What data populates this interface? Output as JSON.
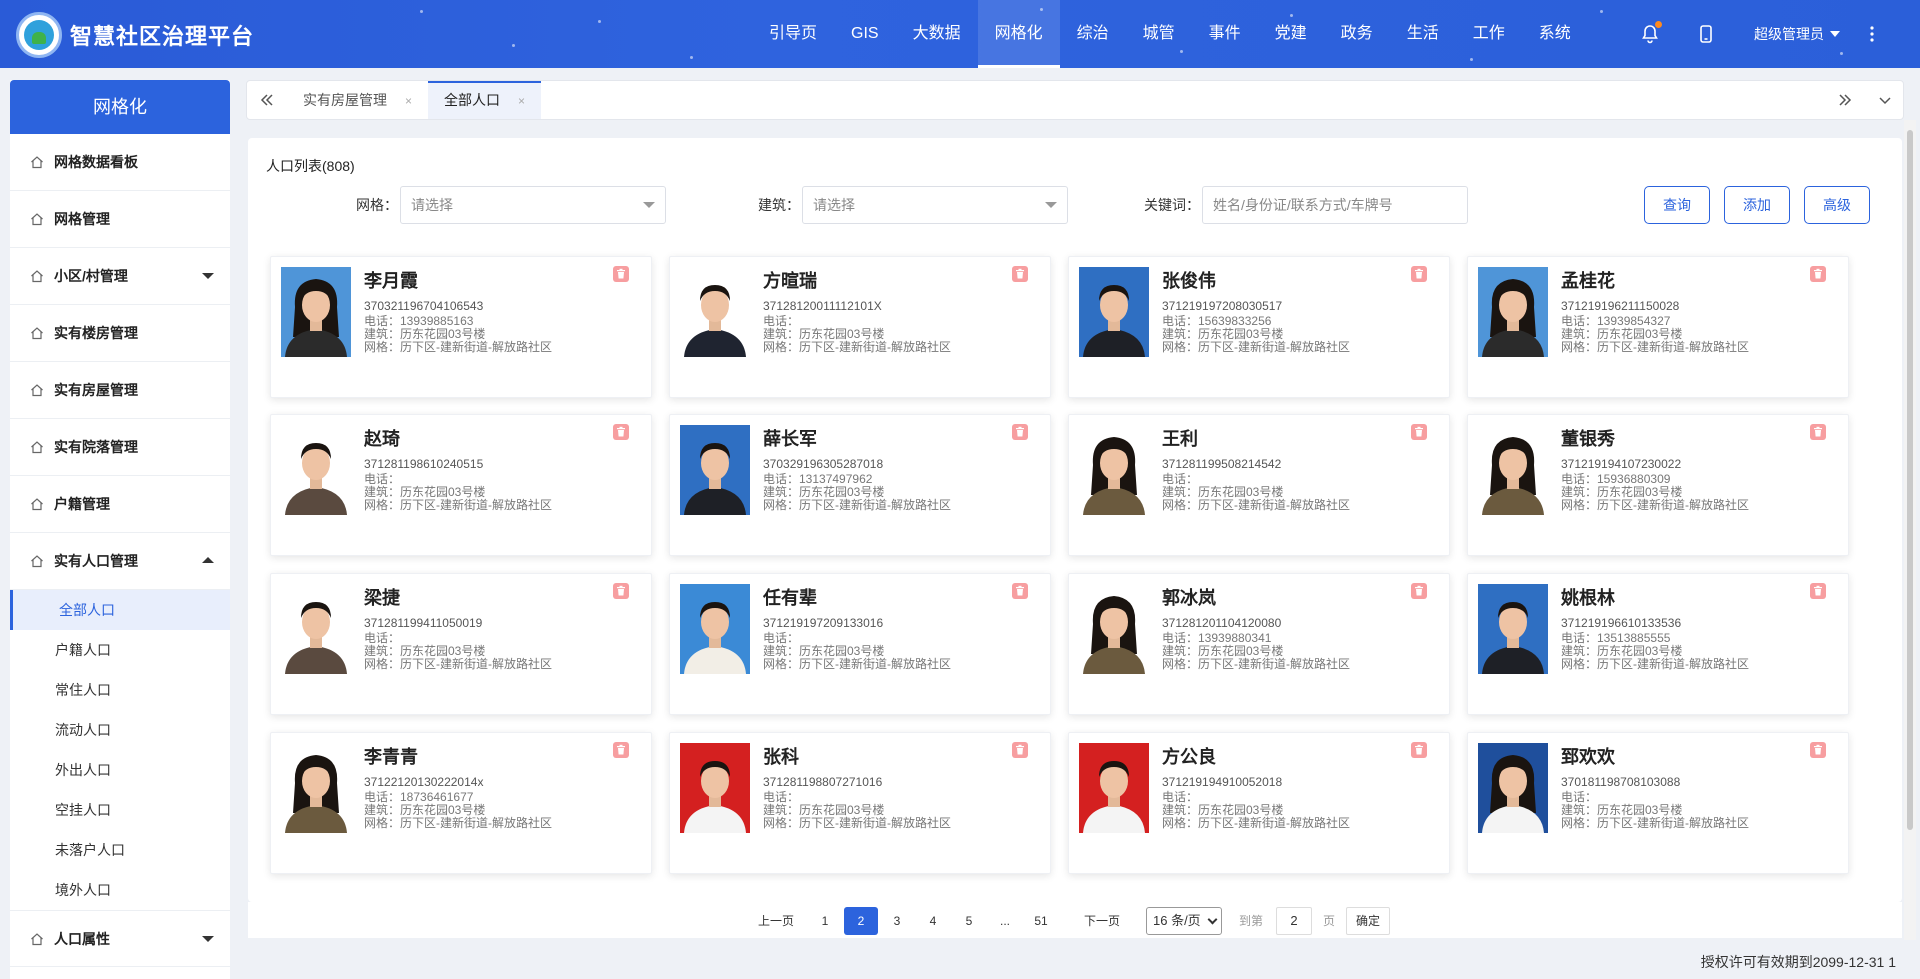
{
  "app": {
    "title": "智慧社区治理平台"
  },
  "topnav": [
    {
      "label": "引导页"
    },
    {
      "label": "GIS"
    },
    {
      "label": "大数据"
    },
    {
      "label": "网格化"
    },
    {
      "label": "综治"
    },
    {
      "label": "城管"
    },
    {
      "label": "事件"
    },
    {
      "label": "党建"
    },
    {
      "label": "政务"
    },
    {
      "label": "生活"
    },
    {
      "label": "工作"
    },
    {
      "label": "系统"
    }
  ],
  "header": {
    "user": "超级管理员"
  },
  "sidebar": {
    "title": "网格化",
    "items": [
      {
        "label": "网格数据看板"
      },
      {
        "label": "网格管理"
      },
      {
        "label": "小区/村管理"
      },
      {
        "label": "实有楼房管理"
      },
      {
        "label": "实有房屋管理"
      },
      {
        "label": "实有院落管理"
      },
      {
        "label": "户籍管理"
      },
      {
        "label": "实有人口管理"
      }
    ],
    "subitems": [
      {
        "label": "全部人口"
      },
      {
        "label": "户籍人口"
      },
      {
        "label": "常住人口"
      },
      {
        "label": "流动人口"
      },
      {
        "label": "外出人口"
      },
      {
        "label": "空挂人口"
      },
      {
        "label": "未落户人口"
      },
      {
        "label": "境外人口"
      }
    ],
    "last_item": {
      "label": "人口属性"
    }
  },
  "tabs": [
    {
      "label": "实有房屋管理",
      "close": "×"
    },
    {
      "label": "全部人口",
      "close": "×"
    }
  ],
  "main": {
    "list_title": "人口列表(808)",
    "filters": {
      "grid_label": "网格：",
      "grid_placeholder": "请选择",
      "building_label": "建筑：",
      "building_placeholder": "请选择",
      "keyword_label": "关键词：",
      "keyword_placeholder": "姓名/身份证/联系方式/车牌号"
    },
    "buttons": {
      "query": "查询",
      "add": "添加",
      "advanced": "高级"
    }
  },
  "people": [
    {
      "name": "李月霞",
      "id": "370321196704106543",
      "phone": "电话：13939885163",
      "building": "建筑：历东花园03号楼",
      "grid": "网格：历下区-建新街道-解放路社区",
      "photo_bg": "#4f95d8",
      "gender": "f",
      "clothes": "#2b2b2b"
    },
    {
      "name": "方暄瑞",
      "id": "37128120011112101X",
      "phone": "电话：",
      "building": "建筑：历东花园03号楼",
      "grid": "网格：历下区-建新街道-解放路社区",
      "photo_bg": "#ffffff",
      "gender": "m",
      "clothes": "#1f2430"
    },
    {
      "name": "张俊伟",
      "id": "371219197208030517",
      "phone": "电话：15639833256",
      "building": "建筑：历东花园03号楼",
      "grid": "网格：历下区-建新街道-解放路社区",
      "photo_bg": "#2f6fc2",
      "gender": "m",
      "clothes": "#1e2026"
    },
    {
      "name": "孟桂花",
      "id": "371219196211150028",
      "phone": "电话：13939854327",
      "building": "建筑：历东花园03号楼",
      "grid": "网格：历下区-建新街道-解放路社区",
      "photo_bg": "#4f95d8",
      "gender": "f",
      "clothes": "#2b2b2b"
    },
    {
      "name": "赵琦",
      "id": "371281198610240515",
      "phone": "电话：",
      "building": "建筑：历东花园03号楼",
      "grid": "网格：历下区-建新街道-解放路社区",
      "photo_bg": "#ffffff",
      "gender": "m",
      "clothes": "#5a4a3f"
    },
    {
      "name": "薛长军",
      "id": "370329196305287018",
      "phone": "电话：13137497962",
      "building": "建筑：历东花园03号楼",
      "grid": "网格：历下区-建新街道-解放路社区",
      "photo_bg": "#2f6fc2",
      "gender": "m",
      "clothes": "#1e2026"
    },
    {
      "name": "王利",
      "id": "371281199508214542",
      "phone": "电话：",
      "building": "建筑：历东花园03号楼",
      "grid": "网格：历下区-建新街道-解放路社区",
      "photo_bg": "#ffffff",
      "gender": "f",
      "clothes": "#6b5a3e"
    },
    {
      "name": "董银秀",
      "id": "371219194107230022",
      "phone": "电话：15936880309",
      "building": "建筑：历东花园03号楼",
      "grid": "网格：历下区-建新街道-解放路社区",
      "photo_bg": "#ffffff",
      "gender": "f",
      "clothes": "#6b5a3e"
    },
    {
      "name": "梁捷",
      "id": "371281199411050019",
      "phone": "电话：",
      "building": "建筑：历东花园03号楼",
      "grid": "网格：历下区-建新街道-解放路社区",
      "photo_bg": "#ffffff",
      "gender": "m",
      "clothes": "#5a4a3f"
    },
    {
      "name": "任有辈",
      "id": "371219197209133016",
      "phone": "电话：",
      "building": "建筑：历东花园03号楼",
      "grid": "网格：历下区-建新街道-解放路社区",
      "photo_bg": "#3b8ad6",
      "gender": "m",
      "clothes": "#f2eee6"
    },
    {
      "name": "郭冰岚",
      "id": "371281201104120080",
      "phone": "电话：13939880341",
      "building": "建筑：历东花园03号楼",
      "grid": "网格：历下区-建新街道-解放路社区",
      "photo_bg": "#ffffff",
      "gender": "f",
      "clothes": "#6b5a3e"
    },
    {
      "name": "姚根林",
      "id": "371219196610133536",
      "phone": "电话：13513885555",
      "building": "建筑：历东花园03号楼",
      "grid": "网格：历下区-建新街道-解放路社区",
      "photo_bg": "#2f6fc2",
      "gender": "m",
      "clothes": "#1e2026"
    },
    {
      "name": "李青青",
      "id": "37122120130222014x",
      "phone": "电话：18736461677",
      "building": "建筑：历东花园03号楼",
      "grid": "网格：历下区-建新街道-解放路社区",
      "photo_bg": "#ffffff",
      "gender": "f",
      "clothes": "#6b5a3e"
    },
    {
      "name": "张科",
      "id": "371281198807271016",
      "phone": "电话：",
      "building": "建筑：历东花园03号楼",
      "grid": "网格：历下区-建新街道-解放路社区",
      "photo_bg": "#d42020",
      "gender": "m",
      "clothes": "#f4f4f4"
    },
    {
      "name": "方公良",
      "id": "371219194910052018",
      "phone": "电话：",
      "building": "建筑：历东花园03号楼",
      "grid": "网格：历下区-建新街道-解放路社区",
      "photo_bg": "#d42020",
      "gender": "m",
      "clothes": "#f4f4f4"
    },
    {
      "name": "郅欢欢",
      "id": "370181198708103088",
      "phone": "电话：",
      "building": "建筑：历东花园03号楼",
      "grid": "网格：历下区-建新街道-解放路社区",
      "photo_bg": "#1f4f9c",
      "gender": "f",
      "clothes": "#f4f4f4"
    }
  ],
  "pagination": {
    "prev": "上一页",
    "next": "下一页",
    "pages": [
      "1",
      "2",
      "3",
      "4",
      "5",
      "...",
      "51"
    ],
    "current": "2",
    "page_size": "16 条/页",
    "goto_label": "到第",
    "goto_value": "2",
    "page_unit": "页",
    "confirm": "确定"
  },
  "footer": {
    "license": "授权许可有效期到2099-12-31 1"
  },
  "colors": {
    "primary": "#2c63dd",
    "delete": "#f79ea0"
  }
}
